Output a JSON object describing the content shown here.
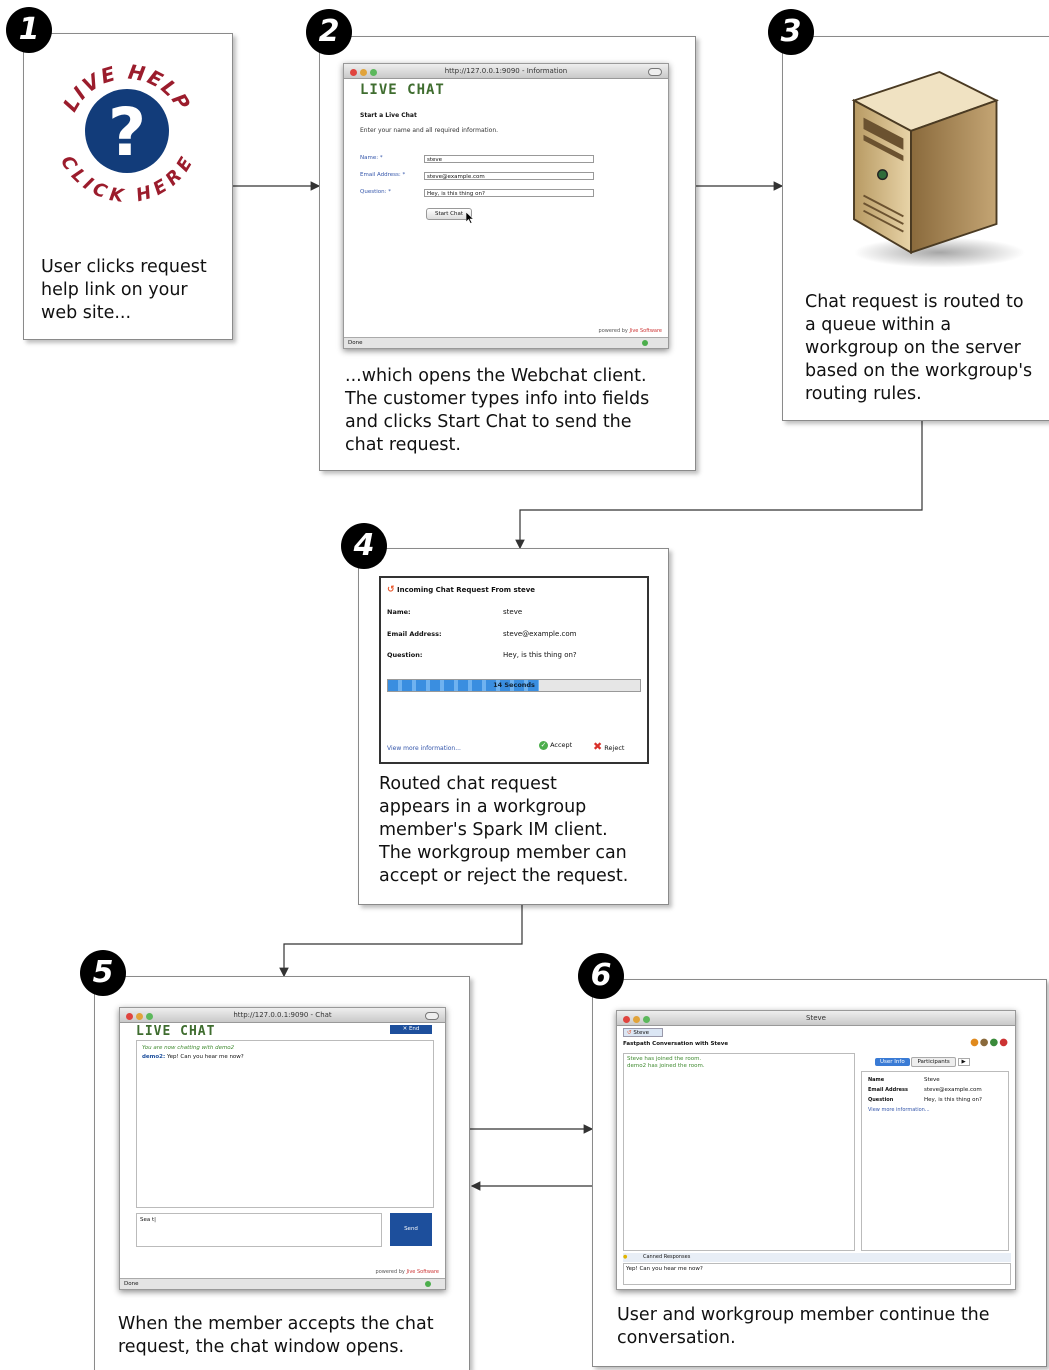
{
  "steps": [
    {
      "number": "1",
      "caption": "User clicks request\nhelp link on your\nweb site..."
    },
    {
      "number": "2",
      "caption": "...which opens the Webchat client.\nThe customer types info into fields\nand clicks Start Chat to send the\nchat request."
    },
    {
      "number": "3",
      "caption": "Chat request is routed to\na queue within a\nworkgroup on the server\nbased on the workgroup's\nrouting rules."
    },
    {
      "number": "4",
      "caption": "Routed chat request\nappears in a workgroup\nmember's Spark IM client.\nThe workgroup member can\naccept or reject the request."
    },
    {
      "number": "5",
      "caption": "When the member accepts the chat\nrequest, the chat window opens."
    },
    {
      "number": "6",
      "caption": "User and workgroup member continue the\nconversation."
    }
  ],
  "live_help_logo": {
    "top_text": "LIVE HELP",
    "bottom_text": "CLICK HERE",
    "symbol": "?",
    "ring_color": "#9b1c2c",
    "circle_color": "#123c7a"
  },
  "webchat_form": {
    "window_title": "http://127.0.0.1:9090 - Information",
    "heading": "LIVE CHAT",
    "subheading": "Start a Live Chat",
    "instructions": "Enter your name and all required information.",
    "labels": [
      "Name: *",
      "Email Address: *",
      "Question: *"
    ],
    "values": [
      "steve",
      "steve@example.com",
      "Hey, is this thing on?"
    ],
    "button": "Start Chat",
    "status": "Done",
    "powered_prefix": "powered by",
    "powered_brand": "Jive Software"
  },
  "incoming_request": {
    "title": "Incoming Chat Request From steve",
    "rows": [
      {
        "label": "Name:",
        "value": "steve"
      },
      {
        "label": "Email Address:",
        "value": "steve@example.com"
      },
      {
        "label": "Question:",
        "value": "Hey, is this thing on?"
      }
    ],
    "progress_label": "14 Seconds",
    "progress": 0.6,
    "more_link": "View more information...",
    "accept": "Accept",
    "reject": "Reject"
  },
  "chat_window": {
    "window_title": "http://127.0.0.1:9090 - Chat",
    "heading": "LIVE CHAT",
    "end_button": "End",
    "line1": "You are now chatting with demo2",
    "speaker": "demo2:",
    "message": "Yep! Can you hear me now?",
    "input_text": "Sea t|",
    "send_button": "Send",
    "status": "Done",
    "powered_prefix": "powered by",
    "powered_brand": "Jive Software"
  },
  "spark_window": {
    "window_title": "Steve",
    "tab": "Steve",
    "conversation_title": "Fastpath Conversation with Steve",
    "system_lines": [
      "Steve has joined the room.",
      "demo2 has joined the room."
    ],
    "side_tabs": [
      "User Info",
      "Participants"
    ],
    "info_rows": [
      {
        "label": "Name",
        "value": "Steve"
      },
      {
        "label": "Email Address",
        "value": "steve@example.com"
      },
      {
        "label": "Question",
        "value": "Hey, is this thing on?"
      }
    ],
    "more_link": "View more information...",
    "canned": "Canned Responses",
    "input_text": "Yep! Can you hear me now?"
  },
  "colors": {
    "badge": "#000000",
    "panel_border": "#8a8a8a",
    "connector": "#333333",
    "live_chat_green": "#3f6d2f",
    "link_blue": "#3355aa",
    "progress_blue": "#3a8ee0"
  }
}
